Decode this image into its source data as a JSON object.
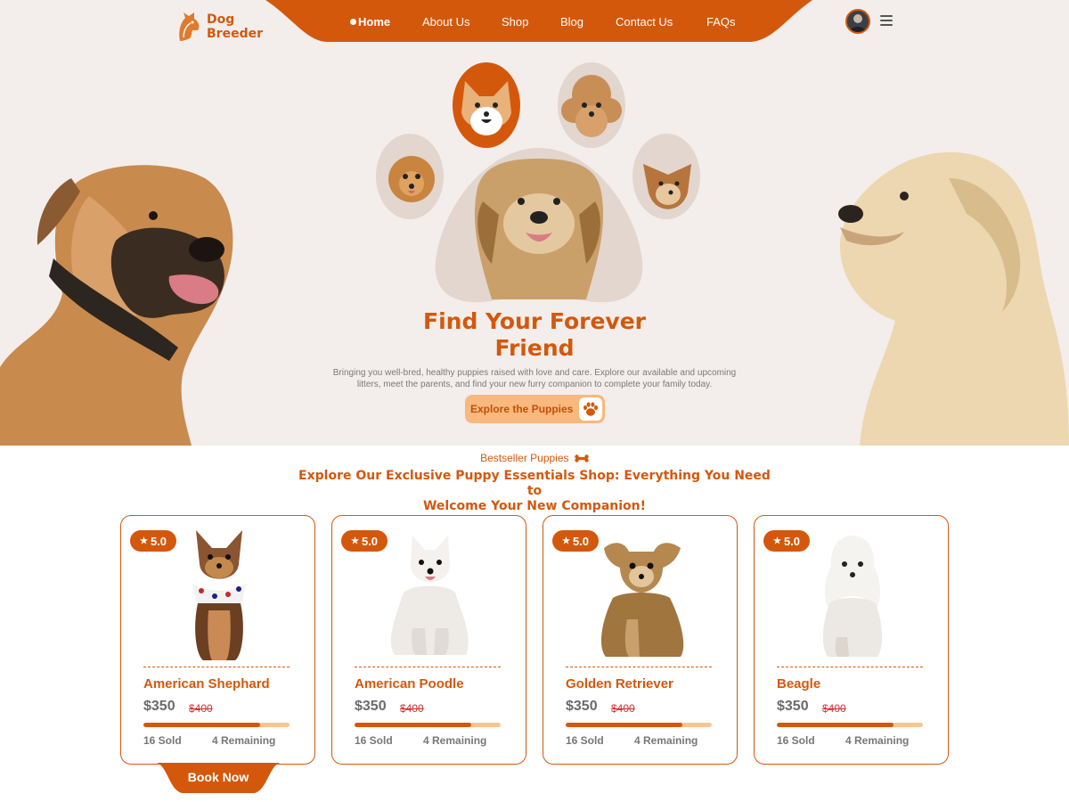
{
  "brand": {
    "line1": "Dog",
    "line2": "Breeder"
  },
  "nav": {
    "items": [
      {
        "label": "Home",
        "active": true
      },
      {
        "label": "About Us"
      },
      {
        "label": "Shop"
      },
      {
        "label": "Blog"
      },
      {
        "label": "Contact Us"
      },
      {
        "label": "FAQs"
      }
    ]
  },
  "hero": {
    "title_line1": "Find Your Forever",
    "title_line2": "Friend",
    "description_line1": "Bringing you well-bred, healthy puppies raised with love and care. Explore our available and upcoming",
    "description_line2": "litters, meet the parents, and find your new furry companion to complete your family today.",
    "cta_label": "Explore the Puppies"
  },
  "section": {
    "kicker": "Bestseller Puppies",
    "title_line1": "Explore Our Exclusive Puppy Essentials Shop: Everything You Need to",
    "title_line2": "Welcome Your New Companion!"
  },
  "products": [
    {
      "name": "American Shephard",
      "rating": "5.0",
      "price": "$350",
      "old_price": "$400",
      "sold": "16 Sold",
      "remaining": "4 Remaining",
      "progress": 0.8
    },
    {
      "name": "American Poodle",
      "rating": "5.0",
      "price": "$350",
      "old_price": "$400",
      "sold": "16 Sold",
      "remaining": "4 Remaining",
      "progress": 0.8
    },
    {
      "name": "Golden Retriever",
      "rating": "5.0",
      "price": "$350",
      "old_price": "$400",
      "sold": "16 Sold",
      "remaining": "4 Remaining",
      "progress": 0.8
    },
    {
      "name": "Beagle",
      "rating": "5.0",
      "price": "$350",
      "old_price": "$400",
      "sold": "16 Sold",
      "remaining": "4 Remaining",
      "progress": 0.8
    }
  ],
  "book_now_label": "Book Now",
  "colors": {
    "accent": "#d4580c",
    "accent_light": "#f8b87e",
    "hero_bg": "#f3eeeb",
    "old_price": "#d32f2f"
  },
  "icons": [
    "dog-logo-icon",
    "menu-icon",
    "paw-icon",
    "bone-icon",
    "star-icon"
  ]
}
